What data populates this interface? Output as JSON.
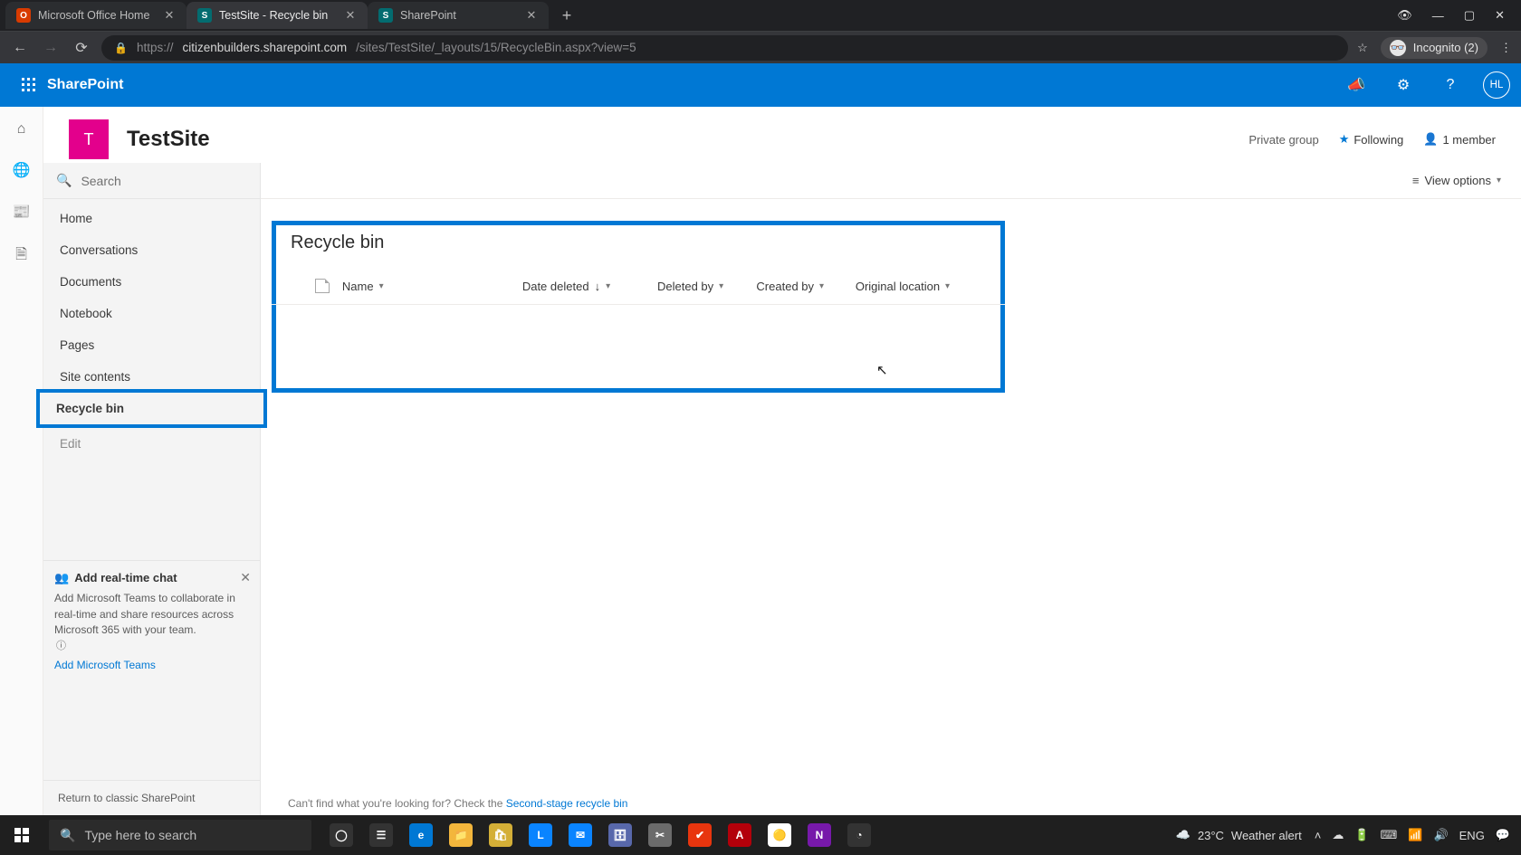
{
  "browser": {
    "tabs": [
      {
        "title": "Microsoft Office Home",
        "favicon_bg": "#d83b01",
        "favicon_text": "O",
        "active": false
      },
      {
        "title": "TestSite - Recycle bin",
        "favicon_bg": "#036c70",
        "favicon_text": "S",
        "active": true
      },
      {
        "title": "SharePoint",
        "favicon_bg": "#036c70",
        "favicon_text": "S",
        "active": false
      }
    ],
    "url_scheme": "https://",
    "url_host": "citizenbuilders.sharepoint.com",
    "url_path": "/sites/TestSite/_layouts/15/RecycleBin.aspx?view=5",
    "incognito_label": "Incognito (2)"
  },
  "suite": {
    "app_name": "SharePoint",
    "avatar_initials": "HL"
  },
  "site": {
    "logo_letter": "T",
    "title": "TestSite",
    "privacy": "Private group",
    "following_label": "Following",
    "members_label": "1 member"
  },
  "sidebar": {
    "search_placeholder": "Search",
    "items": [
      "Home",
      "Conversations",
      "Documents",
      "Notebook",
      "Pages",
      "Site contents",
      "Recycle bin"
    ],
    "selected_index": 6,
    "edit_label": "Edit",
    "return_classic": "Return to classic SharePoint",
    "promo": {
      "title": "Add real-time chat",
      "body": "Add Microsoft Teams to collaborate in real-time and share resources across Microsoft 365 with your team.",
      "link": "Add Microsoft Teams"
    }
  },
  "cmdbar": {
    "view_options": "View options"
  },
  "recycle": {
    "title": "Recycle bin",
    "columns": {
      "name": "Name",
      "date_deleted": "Date deleted",
      "deleted_by": "Deleted by",
      "created_by": "Created by",
      "original_location": "Original location"
    },
    "sort_indicator": "↓"
  },
  "hint": {
    "prefix": "Can't find what you're looking for? Check the ",
    "link": "Second-stage recycle bin"
  },
  "taskbar": {
    "search_placeholder": "Type here to search",
    "weather_temp": "23°C",
    "weather_text": "Weather alert",
    "lang": "ENG",
    "apps": [
      {
        "bg": "#333",
        "txt": "◯"
      },
      {
        "bg": "#333",
        "txt": "☰"
      },
      {
        "bg": "#0078d4",
        "txt": "e"
      },
      {
        "bg": "#f3b63c",
        "txt": "📁"
      },
      {
        "bg": "#d4af37",
        "txt": "🛍"
      },
      {
        "bg": "#0a84ff",
        "txt": "L"
      },
      {
        "bg": "#0a84ff",
        "txt": "✉"
      },
      {
        "bg": "#5868ab",
        "txt": "🗄"
      },
      {
        "bg": "#6b6b6b",
        "txt": "✂"
      },
      {
        "bg": "#e8350e",
        "txt": "✔"
      },
      {
        "bg": "#b3000a",
        "txt": "A"
      },
      {
        "bg": "#ffffff",
        "txt": "🟡"
      },
      {
        "bg": "#7719aa",
        "txt": "N"
      },
      {
        "bg": "#333",
        "txt": "◔"
      }
    ]
  }
}
